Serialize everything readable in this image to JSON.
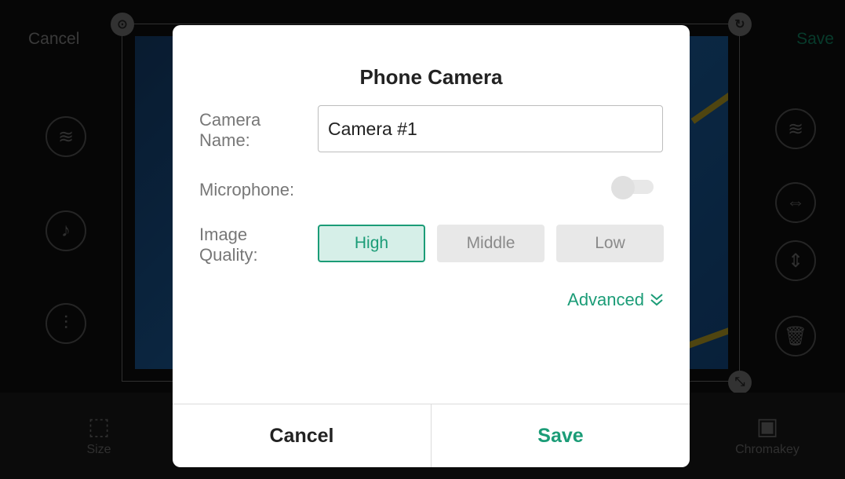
{
  "background": {
    "cancel_label": "Cancel",
    "save_label": "Save",
    "bottom_tools": [
      {
        "label": "Size",
        "icon": "resize-icon"
      },
      {
        "label": "Chromakey",
        "icon": "chromakey-icon"
      }
    ]
  },
  "dialog": {
    "title": "Phone Camera",
    "camera_name": {
      "label_line1": "Camera",
      "label_line2": "Name:",
      "value": "Camera #1"
    },
    "microphone": {
      "label": "Microphone:",
      "enabled": false
    },
    "image_quality": {
      "label_line1": "Image",
      "label_line2": "Quality:",
      "options": [
        "High",
        "Middle",
        "Low"
      ],
      "selected": "High"
    },
    "advanced_label": "Advanced",
    "cancel_label": "Cancel",
    "save_label": "Save"
  },
  "colors": {
    "accent": "#1b9c77",
    "dialog_bg": "#ffffff",
    "backdrop": "#0a0a0a"
  }
}
